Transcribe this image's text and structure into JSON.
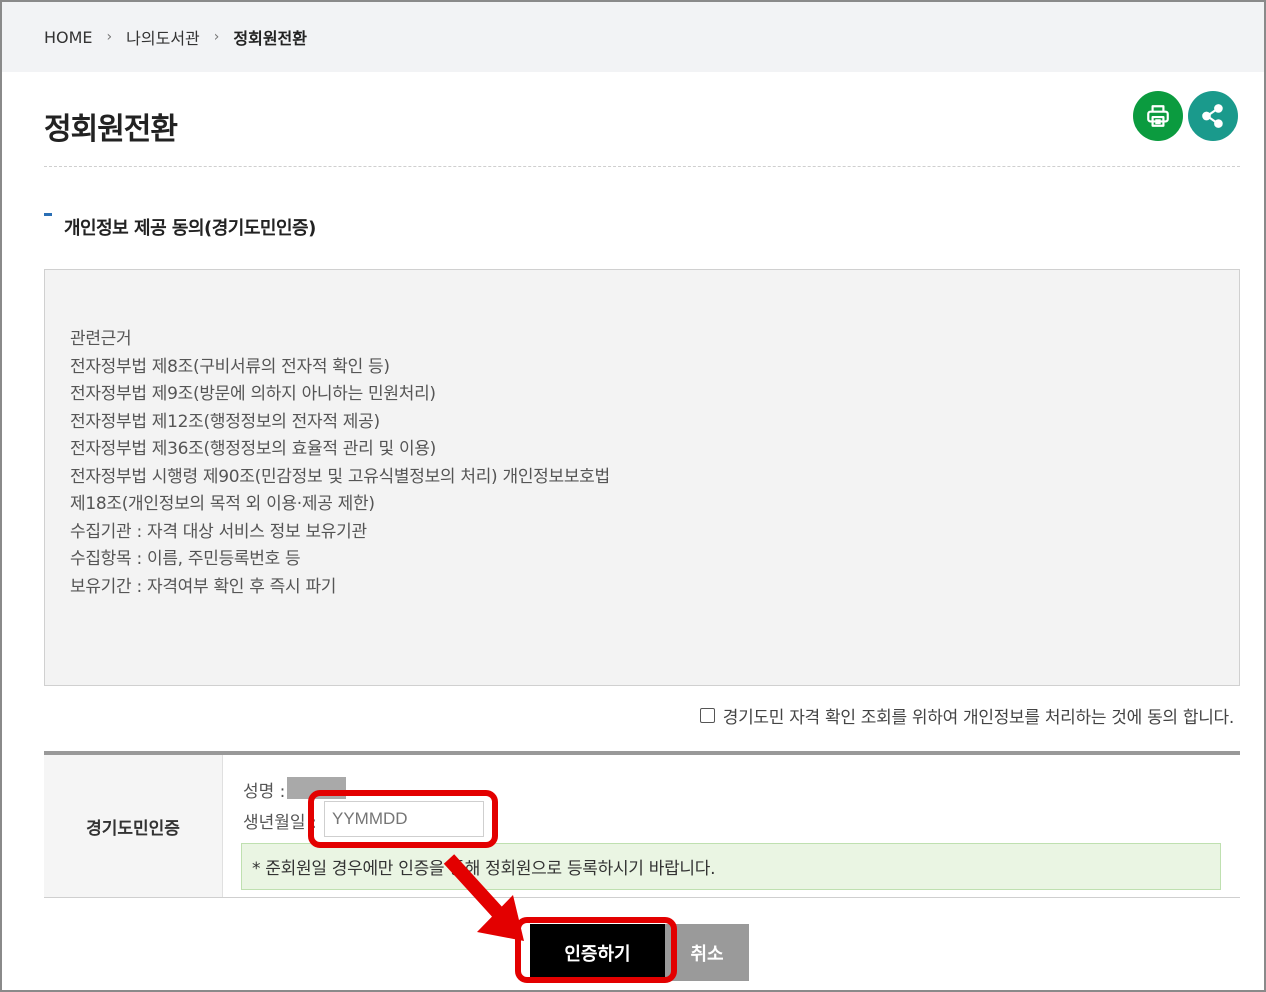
{
  "breadcrumb": {
    "home": "HOME",
    "level1": "나의도서관",
    "current": "정회원전환"
  },
  "page": {
    "title": "정회원전환"
  },
  "actions": {
    "print_icon": "print-icon",
    "share_icon": "share-icon"
  },
  "section": {
    "title": "개인정보 제공 동의(경기도민인증)"
  },
  "terms": {
    "lines": [
      "관련근거",
      "전자정부법 제8조(구비서류의 전자적 확인 등)",
      "전자정부법 제9조(방문에 의하지 아니하는 민원처리)",
      "전자정부법 제12조(행정정보의 전자적 제공)",
      "전자정부법 제36조(행정정보의 효율적 관리 및 이용)",
      "전자정부법 시행령 제90조(민감정보 및 고유식별정보의 처리) 개인정보보호법",
      "제18조(개인정보의 목적 외 이용·제공 제한)",
      "수집기관 : 자격 대상 서비스 정보 보유기관",
      "수집항목 : 이름, 주민등록번호 등",
      "보유기간 : 자격여부 확인 후 즉시 파기"
    ]
  },
  "agree": {
    "label": "경기도민 자격 확인 조회를 위하여 개인정보를 처리하는 것에 동의 합니다."
  },
  "auth": {
    "header": "경기도민인증",
    "name_label": "성명 :",
    "birth_label": "생년월일 :",
    "birth_placeholder": "YYMMDD",
    "notice": "* 준회원일 경우에만 인증을 통해 정회원으로 등록하시기 바랍니다."
  },
  "buttons": {
    "confirm": "인증하기",
    "cancel": "취소"
  },
  "colors": {
    "print": "#0b9b3f",
    "share": "#1a9a8c",
    "highlight": "#e30000",
    "notice_bg": "#eaf5e3"
  }
}
